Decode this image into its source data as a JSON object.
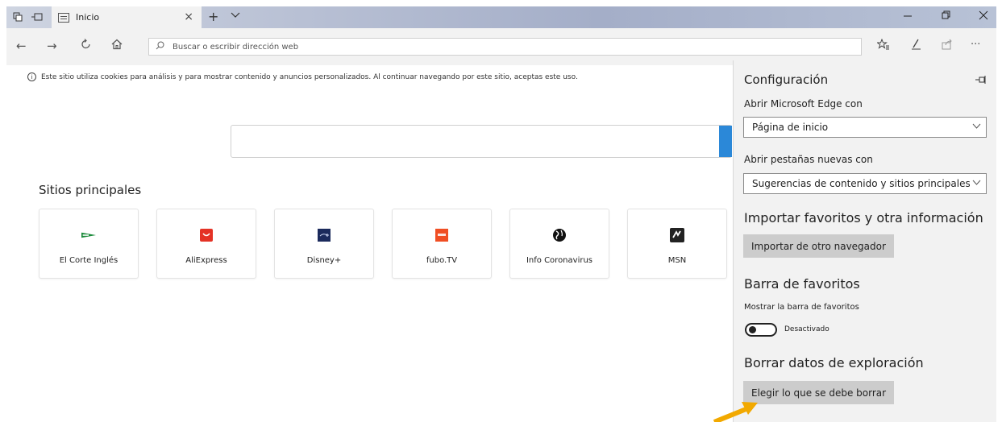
{
  "colors": {
    "accent": "#2b88d8",
    "arrow": "#f2a900",
    "panel_bg": "#f2f2f2"
  },
  "titlebar": {
    "tab_title": "Inicio",
    "icons": [
      "tab-set-aside-icon",
      "show-tabs-icon",
      "new-tab-icon",
      "tab-menu-icon"
    ],
    "window_controls": [
      "minimize-icon",
      "restore-icon",
      "close-icon"
    ]
  },
  "navbar": {
    "address_placeholder": "Buscar o escribir dirección web",
    "icons": [
      "back-icon",
      "forward-icon",
      "refresh-icon",
      "home-icon",
      "search-icon",
      "favorites-icon",
      "pen-icon",
      "share-icon",
      "more-icon"
    ]
  },
  "main": {
    "cookie_notice": "Este sitio utiliza cookies para análisis y para mostrar contenido y anuncios personalizados. Al continuar navegando por este sitio, aceptas este uso.",
    "top_sites_heading": "Sitios principales",
    "tiles": [
      {
        "label": "El Corte Inglés",
        "icon": "el-corte-ingles-icon",
        "color": "#1a8a3a"
      },
      {
        "label": "AliExpress",
        "icon": "aliexpress-icon",
        "color": "#e43225"
      },
      {
        "label": "Disney+",
        "icon": "disney-plus-icon",
        "color": "#1b2a5c"
      },
      {
        "label": "fubo.TV",
        "icon": "fubo-tv-icon",
        "color": "#f04e23"
      },
      {
        "label": "Info Coronavirus",
        "icon": "globe-icon",
        "color": "#111111"
      },
      {
        "label": "MSN",
        "icon": "msn-icon",
        "color": "#222222"
      }
    ]
  },
  "settings": {
    "title": "Configuración",
    "open_with_label": "Abrir Microsoft Edge con",
    "open_with_value": "Página de inicio",
    "new_tabs_label": "Abrir pestañas nuevas con",
    "new_tabs_value": "Sugerencias de contenido y sitios principales",
    "import_heading": "Importar favoritos y otra información",
    "import_button": "Importar de otro navegador",
    "favbar_heading": "Barra de favoritos",
    "favbar_label": "Mostrar la barra de favoritos",
    "favbar_toggle_value": "Desactivado",
    "clear_heading": "Borrar datos de exploración",
    "clear_button": "Elegir lo que se debe borrar"
  }
}
